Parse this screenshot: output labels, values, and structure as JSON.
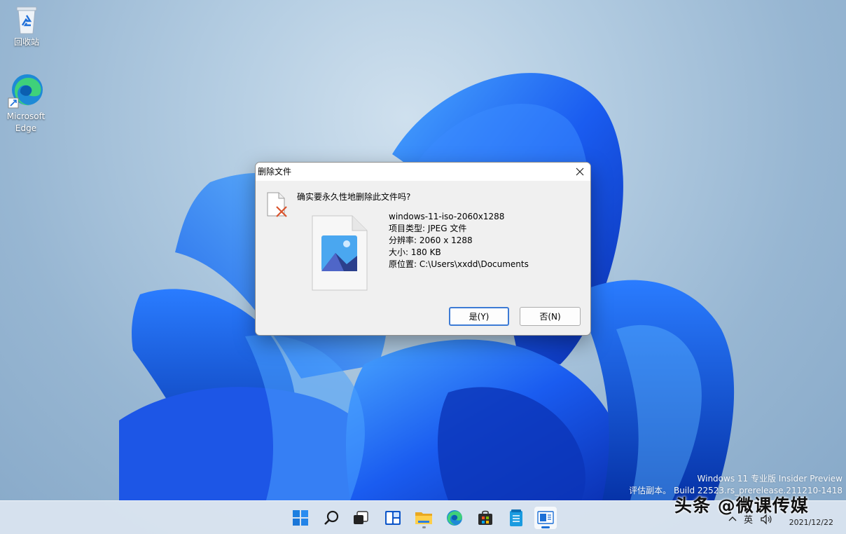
{
  "desktop": {
    "icons": [
      {
        "label": "回收站",
        "icon": "recycle-bin-icon"
      },
      {
        "label_line1": "Microsoft",
        "label_line2": "Edge",
        "icon": "edge-icon"
      }
    ]
  },
  "watermark": {
    "line1": "Windows 11 专业版 Insider Preview",
    "line2": "评估副本。 Build 22523.rs_prerelease.211210-1418"
  },
  "dialog": {
    "title": "删除文件",
    "question": "确实要永久性地删除此文件吗?",
    "file": {
      "name": "windows-11-iso-2060x1288",
      "type": "项目类型: JPEG 文件",
      "resolution": "分辨率: 2060 x 1288",
      "size": "大小: 180 KB",
      "location": "原位置: C:\\Users\\xxdd\\Documents"
    },
    "buttons": {
      "yes": "是(Y)",
      "no": "否(N)"
    }
  },
  "taskbar": {
    "icons": [
      "start-icon",
      "search-icon",
      "task-view-icon",
      "widgets-icon",
      "file-explorer-icon",
      "edge-icon",
      "store-icon",
      "notepad-icon",
      "control-panel-icon"
    ],
    "tray": {
      "ime": "英",
      "volume": "volume-icon",
      "date": "2021/12/22"
    }
  },
  "overlay": {
    "brand": "头条 @微课传媒"
  },
  "colors": {
    "accent": "#1c6fd6",
    "dialog_bg": "#f0f0f0",
    "delete_x": "#d9532c"
  }
}
